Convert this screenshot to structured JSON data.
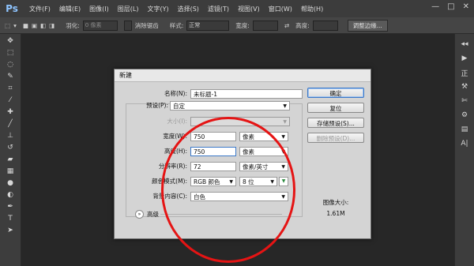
{
  "app": {
    "logo": "Ps"
  },
  "menu": [
    "文件(F)",
    "编辑(E)",
    "图像(I)",
    "图层(L)",
    "文字(Y)",
    "选择(S)",
    "滤镜(T)",
    "视图(V)",
    "窗口(W)",
    "帮助(H)"
  ],
  "window_controls": [
    "—",
    "□",
    "✕"
  ],
  "options_bar": {
    "feather_label": "羽化:",
    "feather_value": "0 像素",
    "antialias_label": "消除锯齿",
    "style_label": "样式:",
    "style_value": "正常",
    "width_label": "宽度:",
    "height_label": "高度:",
    "refine_edge": "调整边缘..."
  },
  "right_panel_labels": [
    "正"
  ],
  "dialog": {
    "title": "新建",
    "name_label": "名称(N):",
    "name_value": "未标题-1",
    "preset_label": "预设(P):",
    "preset_value": "自定",
    "size_label": "大小(I):",
    "width_label": "宽度(W):",
    "width_value": "750",
    "width_unit": "像素",
    "height_label": "高度(H):",
    "height_value": "750",
    "height_unit": "像素",
    "resolution_label": "分辨率(R):",
    "resolution_value": "72",
    "resolution_unit": "像素/英寸",
    "color_mode_label": "颜色模式(M):",
    "color_mode_value": "RGB 颜色",
    "bit_depth_value": "8 位",
    "background_label": "背景内容(C):",
    "background_value": "白色",
    "advanced_label": "高级",
    "ok_button": "确定",
    "reset_button": "复位",
    "save_preset_button": "存储预设(S)...",
    "delete_preset_button": "删除预设(D)...",
    "image_size_label": "图像大小:",
    "image_size_value": "1.61M"
  },
  "colors": {
    "annotation_circle": "#e51414",
    "primary_button_border": "#3b78c8"
  }
}
